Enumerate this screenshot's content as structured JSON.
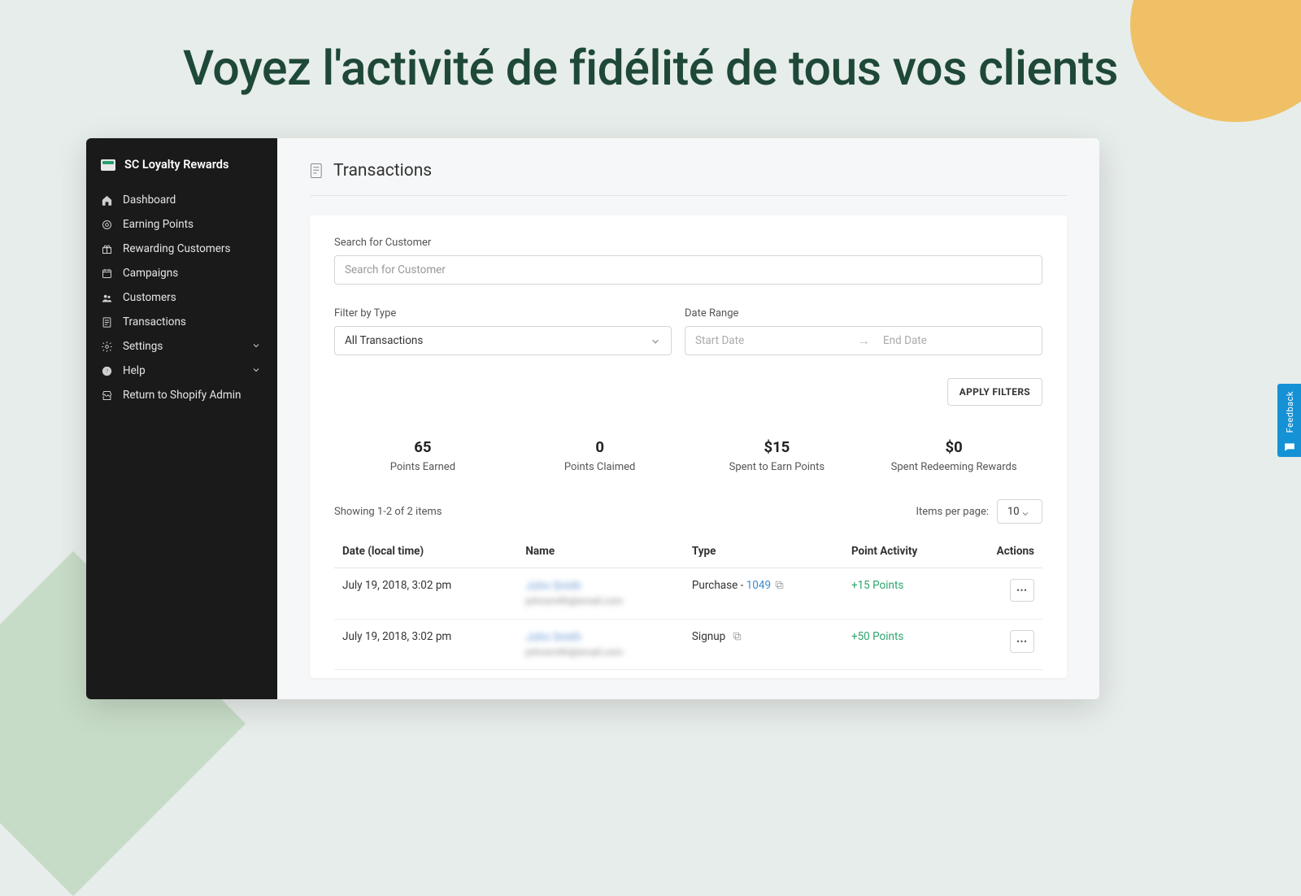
{
  "hero": {
    "title": "Voyez l'activité de fidélité de tous vos clients"
  },
  "app": {
    "brand": "SC Loyalty Rewards",
    "nav": [
      {
        "label": "Dashboard"
      },
      {
        "label": "Earning Points"
      },
      {
        "label": "Rewarding Customers"
      },
      {
        "label": "Campaigns"
      },
      {
        "label": "Customers"
      },
      {
        "label": "Transactions"
      },
      {
        "label": "Settings",
        "expandable": true
      },
      {
        "label": "Help",
        "expandable": true
      },
      {
        "label": "Return to Shopify Admin"
      }
    ],
    "page_title": "Transactions",
    "search": {
      "label": "Search for Customer",
      "placeholder": "Search for Customer"
    },
    "filter_type": {
      "label": "Filter by Type",
      "value": "All Transactions"
    },
    "date_range": {
      "label": "Date Range",
      "start_placeholder": "Start Date",
      "end_placeholder": "End Date"
    },
    "apply_button": "APPLY FILTERS",
    "stats": [
      {
        "value": "65",
        "label": "Points Earned"
      },
      {
        "value": "0",
        "label": "Points Claimed"
      },
      {
        "value": "$15",
        "label": "Spent to Earn Points"
      },
      {
        "value": "$0",
        "label": "Spent Redeeming Rewards"
      }
    ],
    "showing": "Showing 1-2 of 2 items",
    "ipp_label": "Items per page:",
    "ipp_value": "10",
    "columns": {
      "date": "Date (local time)",
      "name": "Name",
      "type": "Type",
      "activity": "Point Activity",
      "actions": "Actions"
    },
    "rows": [
      {
        "date": "July 19, 2018, 3:02 pm",
        "name": "John Smith",
        "email": "johnsmith@email.com",
        "type_prefix": "Purchase - ",
        "type_link": "1049",
        "points": "+15 Points"
      },
      {
        "date": "July 19, 2018, 3:02 pm",
        "name": "John Smith",
        "email": "johnsmith@email.com",
        "type_prefix": "Signup ",
        "type_link": "",
        "points": "+50 Points"
      }
    ],
    "feedback": "Feedback"
  }
}
